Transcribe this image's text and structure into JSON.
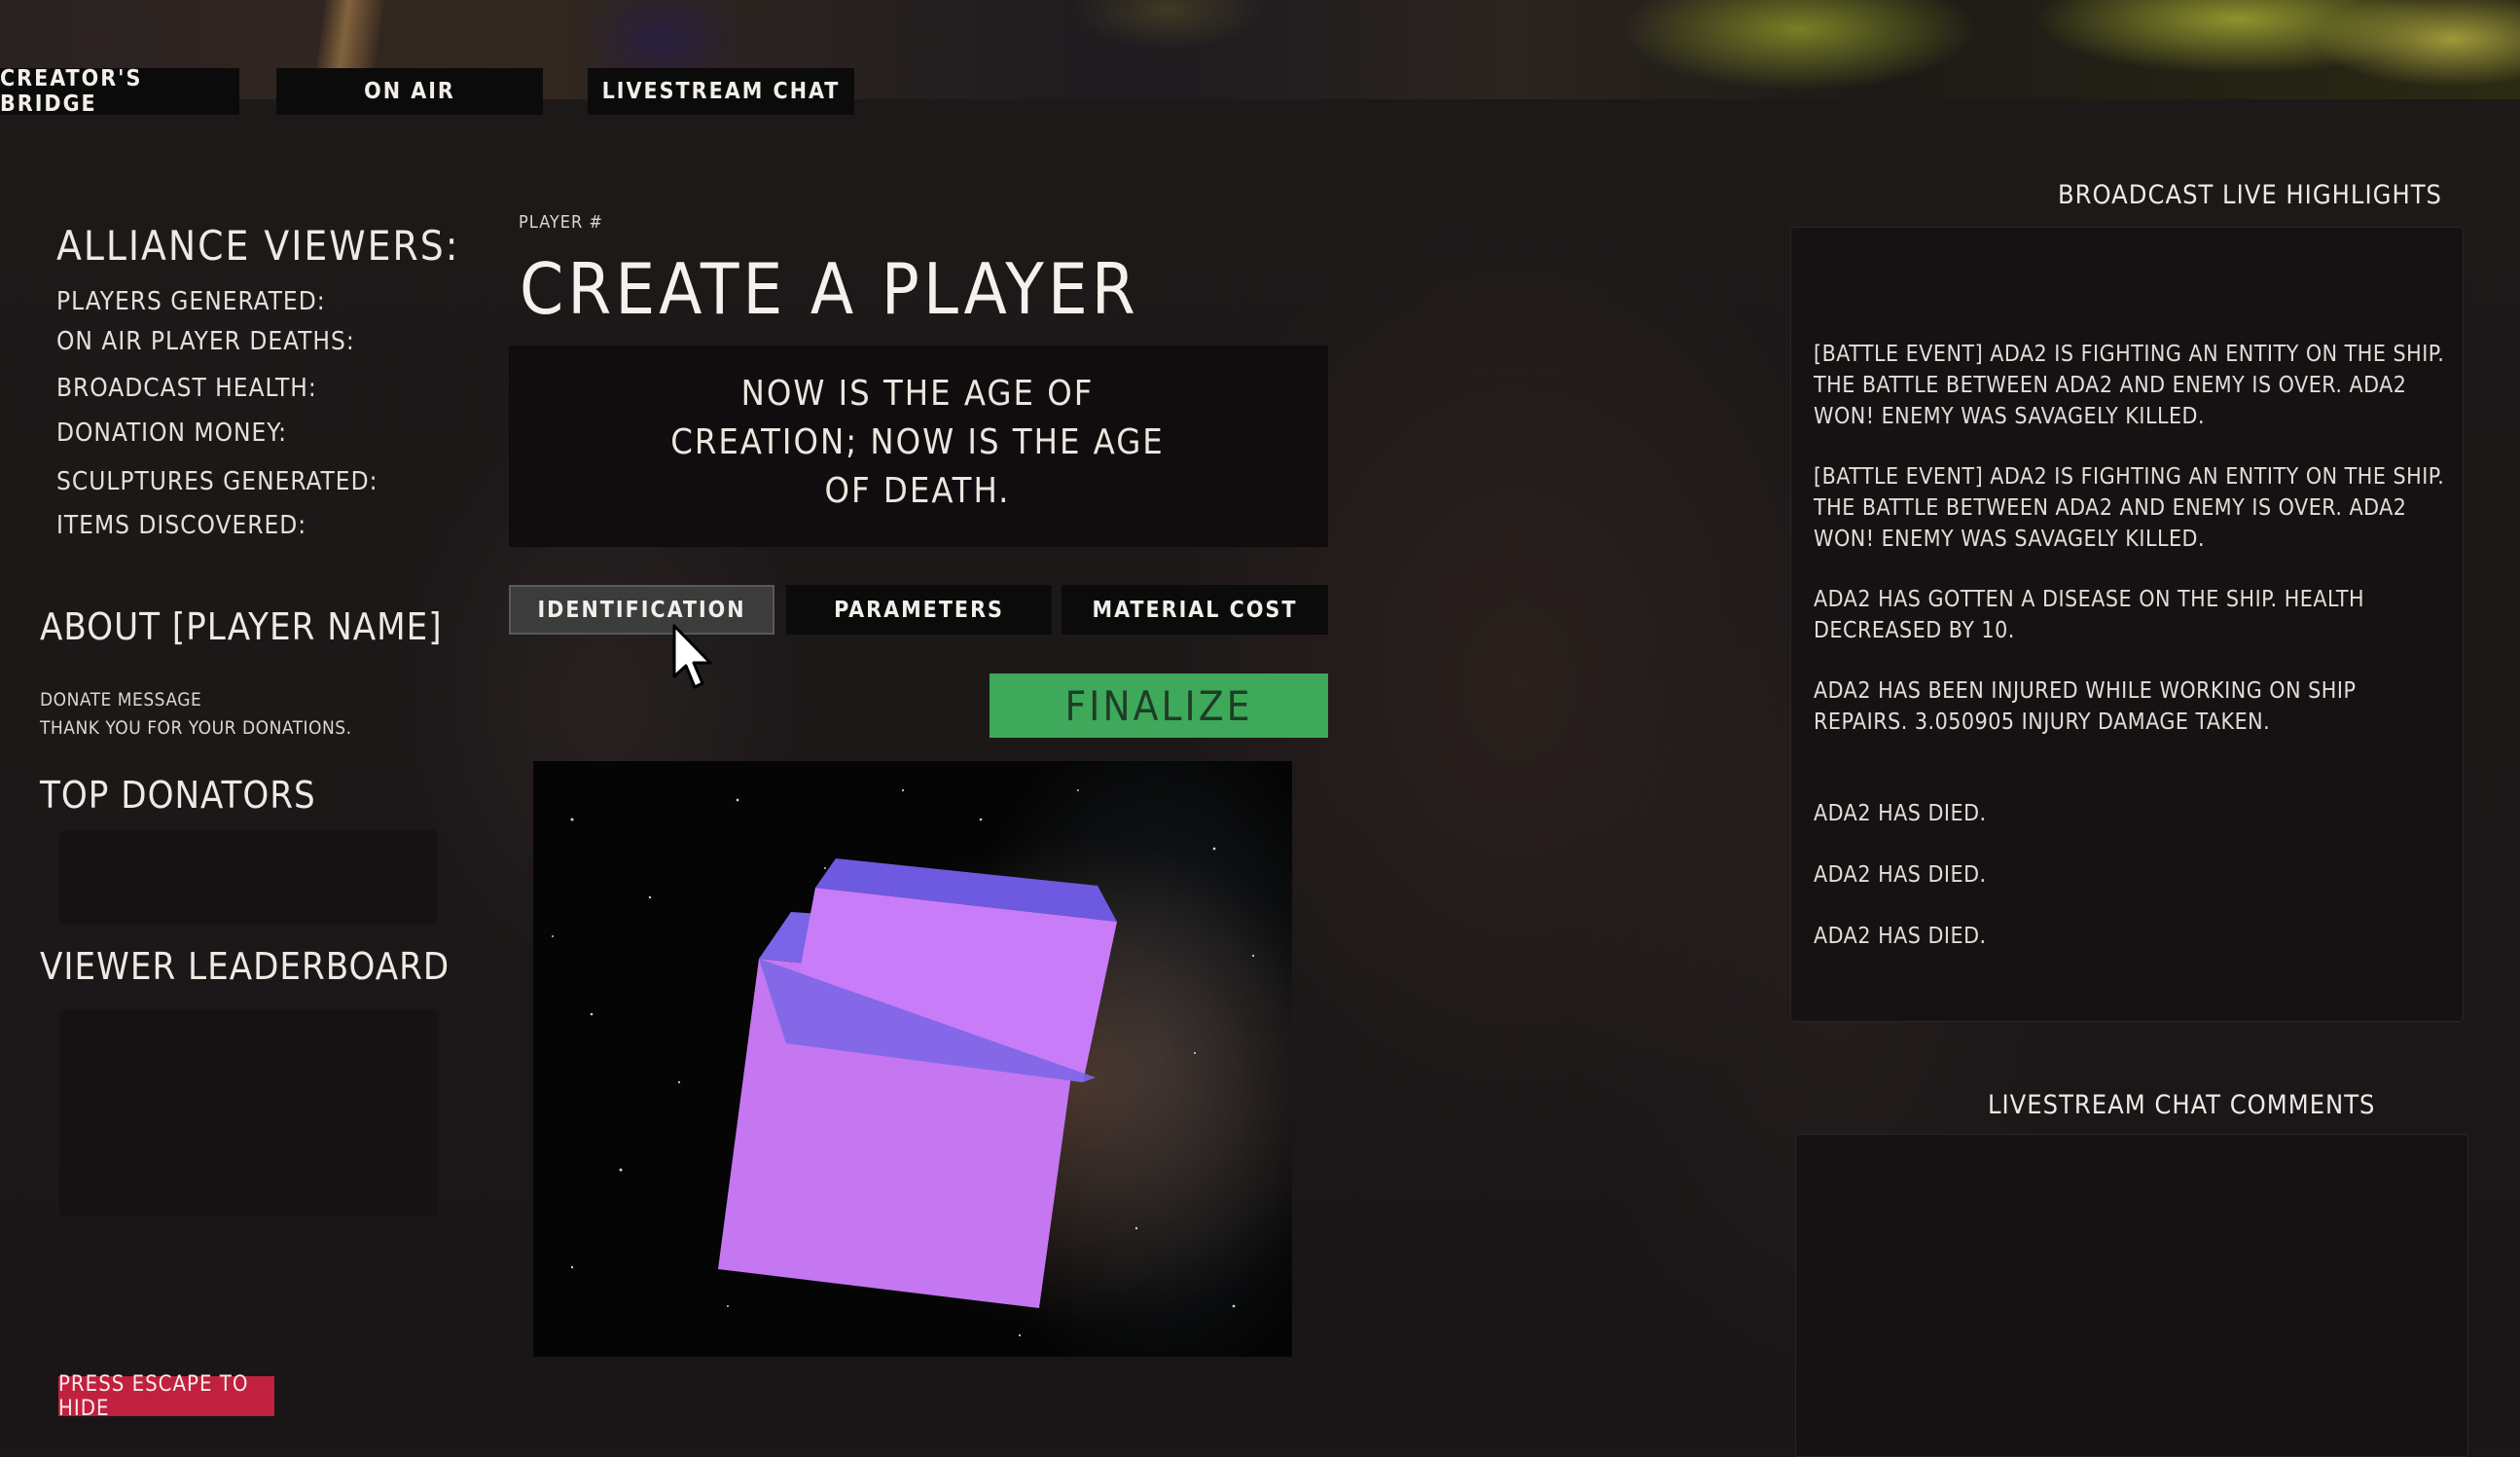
{
  "nav": {
    "tabs": [
      {
        "label": "CREATOR'S BRIDGE"
      },
      {
        "label": "ON AIR"
      },
      {
        "label": "LIVESTREAM CHAT"
      }
    ]
  },
  "left_panel": {
    "alliance_title": "ALLIANCE VIEWERS:",
    "stats": [
      "PLAYERS GENERATED:",
      "ON AIR PLAYER DEATHS:",
      "BROADCAST HEALTH:",
      "DONATION MONEY:",
      "SCULPTURES GENERATED:",
      "ITEMS DISCOVERED:"
    ],
    "about_title": "ABOUT [PLAYER NAME]",
    "donate_message": "DONATE MESSAGE",
    "thanks_message": "THANK YOU FOR YOUR DONATIONS.",
    "top_donators_title": "TOP DONATORS",
    "viewer_leaderboard_title": "VIEWER LEADERBOARD",
    "escape_label": "PRESS ESCAPE TO HIDE"
  },
  "center": {
    "player_number_label": "PLAYER #",
    "title": "CREATE A PLAYER",
    "quote": "NOW IS THE AGE OF CREATION; NOW IS THE AGE OF DEATH.",
    "tabs": [
      {
        "label": "IDENTIFICATION",
        "active": true
      },
      {
        "label": "PARAMETERS",
        "active": false
      },
      {
        "label": "MATERIAL COST",
        "active": false
      }
    ],
    "finalize_label": "FINALIZE",
    "preview_object_color": "#c07cf6"
  },
  "right_panel": {
    "highlights_title": "BROADCAST LIVE HIGHLIGHTS",
    "highlights": [
      "[BATTLE EVENT] ADA2 IS FIGHTING AN ENTITY ON THE SHIP. THE BATTLE BETWEEN ADA2 AND ENEMY IS OVER. ADA2 WON! ENEMY WAS SAVAGELY KILLED.",
      "[BATTLE EVENT] ADA2 IS FIGHTING AN ENTITY ON THE SHIP. THE BATTLE BETWEEN ADA2 AND ENEMY IS OVER. ADA2 WON! ENEMY WAS SAVAGELY KILLED.",
      "ADA2 HAS GOTTEN A DISEASE ON THE SHIP. HEALTH DECREASED BY 10.",
      "ADA2 HAS BEEN INJURED WHILE WORKING ON SHIP REPAIRS. 3.050905 INJURY DAMAGE TAKEN.",
      "ADA2 HAS DIED.",
      "ADA2 HAS DIED.",
      "ADA2 HAS DIED."
    ],
    "chat_title": "LIVESTREAM CHAT COMMENTS"
  }
}
